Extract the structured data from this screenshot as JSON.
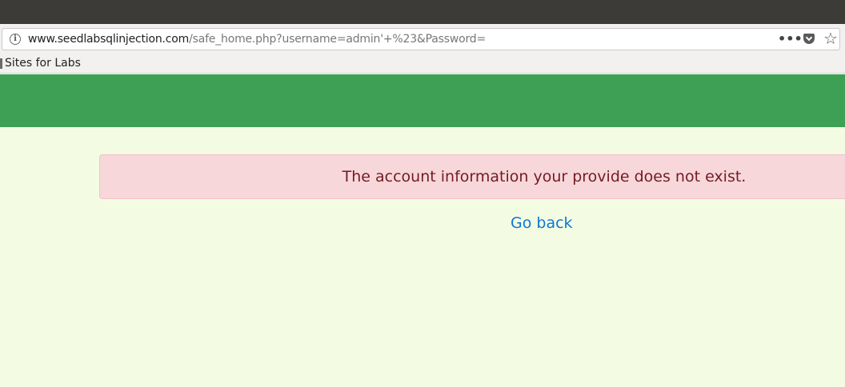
{
  "browser": {
    "url_host": "www.seedlabsqlinjection.com",
    "url_path": "/safe_home.php?username=admin'+%23&Password=",
    "bookmark_label": "Sites for Labs",
    "icons": [
      "info-icon",
      "more-icon",
      "pocket-icon",
      "star-icon",
      "bookmark-folder-icon"
    ]
  },
  "page": {
    "alert_message": "The account information your provide does not exist.",
    "go_back_label": "Go back"
  },
  "colors": {
    "header": "#3ea055",
    "background": "#f3fce3",
    "alert_bg": "#f8d7da",
    "alert_text": "#721c24",
    "link": "#0d77d6"
  }
}
